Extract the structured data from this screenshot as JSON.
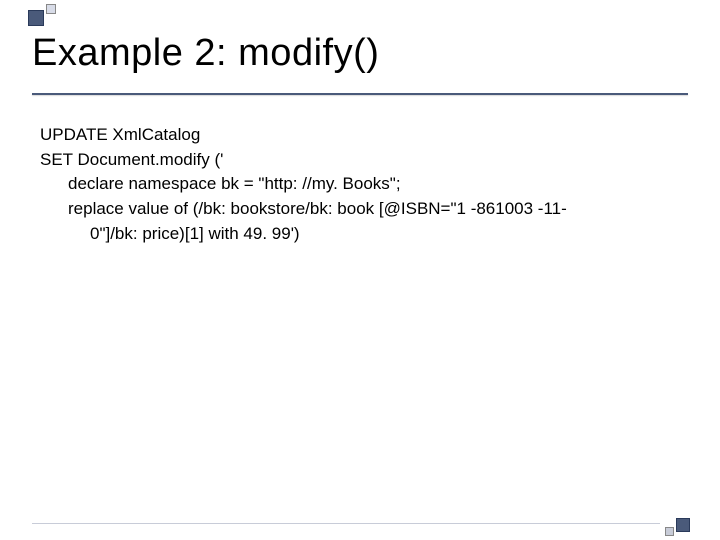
{
  "slide": {
    "title": "Example 2: modify()",
    "code": {
      "line1": "UPDATE XmlCatalog",
      "line2": "SET Document.modify ('",
      "line3": "declare namespace bk = \"http: //my. Books\";",
      "line4": "replace value of (/bk: bookstore/bk: book [@ISBN=\"1 -861003 -11-",
      "line5": "0\"]/bk: price)[1] with 49. 99')"
    }
  }
}
